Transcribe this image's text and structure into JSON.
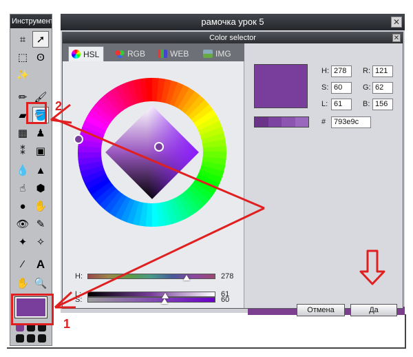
{
  "tools_panel": {
    "title": "Инструмент",
    "main_color": "#793e9c"
  },
  "document": {
    "title": "рамочка урок 5",
    "close_glyph": "✕"
  },
  "dialog": {
    "title": "Color selector",
    "close_glyph": "✕",
    "tabs": [
      {
        "label": "HSL",
        "icon": "hsl-wheel-icon",
        "active": true
      },
      {
        "label": "RGB",
        "icon": "rgb-icon",
        "active": false
      },
      {
        "label": "WEB",
        "icon": "web-grid-icon",
        "active": false
      },
      {
        "label": "IMG",
        "icon": "image-icon",
        "active": false
      }
    ],
    "sliders": {
      "h": {
        "label": "H:",
        "value": "278",
        "fraction": 0.772
      },
      "s": {
        "label": "S:",
        "value": "60",
        "fraction": 0.6
      },
      "l": {
        "label": "L:",
        "value": "61",
        "fraction": 0.61
      }
    },
    "fields": {
      "h": {
        "label": "H:",
        "value": "278"
      },
      "s": {
        "label": "S:",
        "value": "60"
      },
      "l": {
        "label": "L:",
        "value": "61"
      },
      "r": {
        "label": "R:",
        "value": "121"
      },
      "g": {
        "label": "G:",
        "value": "62"
      },
      "b": {
        "label": "B:",
        "value": "156"
      },
      "hex": {
        "label": "#",
        "value": "793e9c"
      }
    },
    "preview_color": "#793e9c",
    "history_colors": [
      "#6a3588",
      "#7c44a0",
      "#8c55b0",
      "#9a68bc"
    ],
    "buttons": {
      "cancel": "Отмена",
      "ok": "Да"
    }
  },
  "annotations": {
    "label_one": "1",
    "label_two": "2",
    "color": "#e02020"
  }
}
